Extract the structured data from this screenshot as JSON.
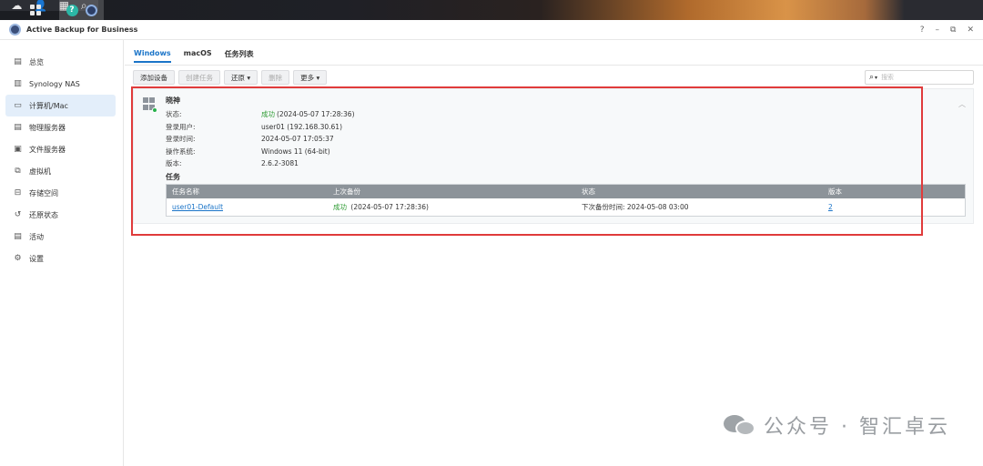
{
  "window": {
    "title": "Active Backup for Business",
    "controls": [
      "?",
      "–",
      "⧉",
      "✕"
    ]
  },
  "sidebar": {
    "items": [
      {
        "label": "总览",
        "icon": "overview-icon"
      },
      {
        "label": "Synology NAS",
        "icon": "nas-icon"
      },
      {
        "label": "计算机/Mac",
        "icon": "computer-icon"
      },
      {
        "label": "物理服务器",
        "icon": "server-icon"
      },
      {
        "label": "文件服务器",
        "icon": "file-server-icon"
      },
      {
        "label": "虚拟机",
        "icon": "vm-icon"
      },
      {
        "label": "存储空间",
        "icon": "storage-icon"
      },
      {
        "label": "还原状态",
        "icon": "restore-icon"
      },
      {
        "label": "活动",
        "icon": "activity-icon"
      },
      {
        "label": "设置",
        "icon": "gear-icon"
      }
    ],
    "active_index": 2
  },
  "tabs": [
    {
      "label": "Windows",
      "active": true
    },
    {
      "label": "macOS",
      "active": false
    },
    {
      "label": "任务列表",
      "active": false
    }
  ],
  "toolbar": {
    "add_device": "添加设备",
    "create_task": "创建任务",
    "restore": "还原",
    "delete": "删除",
    "more": "更多"
  },
  "search": {
    "placeholder": "搜索"
  },
  "device": {
    "name": "晓神",
    "info": [
      {
        "label": "状态:",
        "value": "成功",
        "extra": "(2024-05-07 17:28:36)"
      },
      {
        "label": "登录用户:",
        "value": "user01 (192.168.30.61)"
      },
      {
        "label": "登录时间:",
        "value": "2024-05-07 17:05:37"
      },
      {
        "label": "操作系统:",
        "value": "Windows 11 (64-bit)"
      },
      {
        "label": "版本:",
        "value": "2.6.2-3081"
      }
    ],
    "tasks_title": "任务",
    "table": {
      "headers": [
        "任务名称",
        "上次备份",
        "状态",
        "版本"
      ],
      "rows": [
        {
          "name": "user01-Default",
          "last_backup_status": "成功",
          "last_backup_time": "(2024-05-07 17:28:36)",
          "status": "下次备份时间: 2024-05-08 03:00",
          "versions": "2"
        }
      ]
    }
  },
  "watermark": {
    "text": "公众号 · 智汇卓云"
  },
  "colors": {
    "accent": "#1a74c8",
    "success": "#2e9b33",
    "highlight_frame": "#e03b3b",
    "table_header": "#8c9399"
  }
}
